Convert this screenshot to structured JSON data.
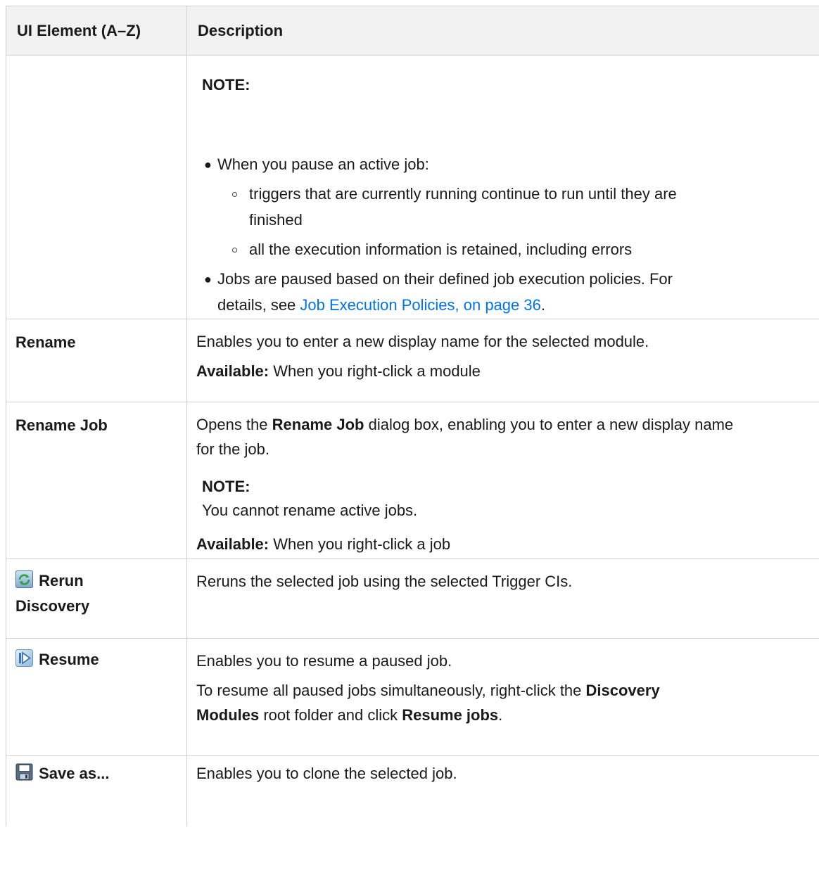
{
  "header": {
    "col1": "UI Element (A–Z)",
    "col2": "Description"
  },
  "row_pause": {
    "note_label": "NOTE:",
    "bullet1": "When you pause an active job:",
    "sub1": "triggers that are currently running continue to run until they are",
    "sub1_cont": "finished",
    "sub2": "all the execution information is retained, including errors",
    "bullet2": "Jobs are paused based on their defined job execution policies. For",
    "bullet2_cont_prefix": "details, see ",
    "bullet2_link": "Job Execution Policies, on page 36",
    "bullet2_suffix": "."
  },
  "row_rename": {
    "element": "Rename",
    "desc": "Enables you to enter a new display name for the selected module.",
    "available_label": "Available:",
    "available_text": " When you right-click a module"
  },
  "row_rename_job": {
    "element": "Rename Job",
    "desc_prefix": "Opens the ",
    "desc_bold": "Rename Job",
    "desc_suffix": " dialog box, enabling you to enter a new display name",
    "desc_cont": "for the job.",
    "note_label": "NOTE:",
    "note_text": "You cannot rename active jobs.",
    "available_label": "Available:",
    "available_text": " When you right-click a job"
  },
  "row_rerun": {
    "icon": "rerun-discovery-icon",
    "element_line1": "Rerun",
    "element_line2": "Discovery",
    "desc": "Reruns the selected job using the selected Trigger CIs."
  },
  "row_resume": {
    "icon": "resume-icon",
    "element": "Resume",
    "desc": "Enables you to resume a paused job.",
    "desc2_prefix": "To resume all paused jobs simultaneously, right-click the ",
    "desc2_bold1": "Discovery",
    "desc2_bold1_cont": "Modules",
    "desc2_mid": " root folder and click ",
    "desc2_bold2": "Resume jobs",
    "desc2_suffix": "."
  },
  "row_save": {
    "icon": "save-icon",
    "element": "Save as...",
    "desc": "Enables you to clone the selected job."
  }
}
